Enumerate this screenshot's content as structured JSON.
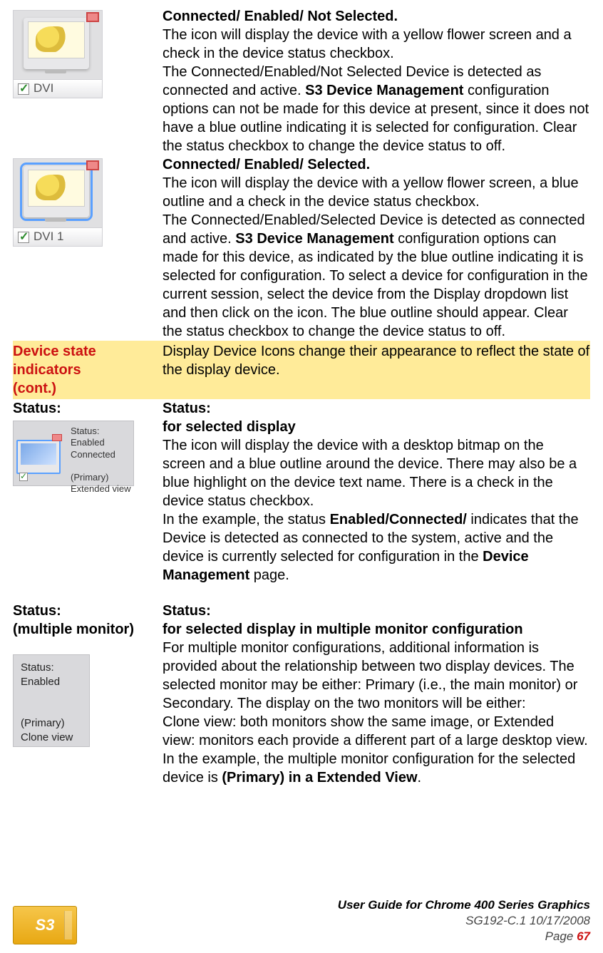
{
  "row1": {
    "icon_label": "DVI",
    "heading": "Connected/ Enabled/ Not Selected.",
    "p1a": "The icon will display the device with a yellow flower screen and a check in the device status checkbox.",
    "p1b_a": "The Connected/Enabled/Not Selected Device is detected as connected and active. ",
    "p1b_bold": "S3 Device Management",
    "p1b_c": " configuration options can not be made for this device at present, since it does not have a blue outline indicating it is selected for configuration. Clear the status checkbox to change the device status to off."
  },
  "row2": {
    "icon_label": "DVI 1",
    "heading": "Connected/ Enabled/ Selected.",
    "p1": "The icon will display the device with a yellow flower screen, a blue outline and a check in the device status checkbox.",
    "p2a": "The Connected/Enabled/Selected Device is detected as connected and active. ",
    "p2bold": "S3 Device Management",
    "p2b": " configuration options can made for this device, as indicated by the blue outline indicating it is selected for configuration. To select a device for configuration in the current session, select the device from the Display dropdown list and then click on the icon. The blue outline should appear. Clear the status checkbox to change the device status to off."
  },
  "yellow": {
    "left_l1": "Device state",
    "left_l2": "indicators",
    "left_l3": "(cont.)",
    "right": "Display Device Icons change their appearance to reflect the state of the display device."
  },
  "status1": {
    "left_heading": "Status:",
    "img_lines": "Status:\nEnabled\nConnected\n\n(Primary)\nExtended view",
    "heading": "Status:",
    "sub": "for selected display",
    "p1": "The icon will display the device with a desktop bitmap on the screen and a blue outline around the device. There may also be a blue highlight on the device text name. There is a check in the device status checkbox.",
    "p2a": "In the example, the status ",
    "p2bold1": "Enabled/Connected/",
    "p2b": " indicates that the Device is detected as connected to the system, active and the device is currently selected for configuration in the ",
    "p2bold2": "Device Management",
    "p2c": " page."
  },
  "status2": {
    "left_l1": "Status:",
    "left_l2": "(multiple monitor)",
    "img_lines": "Status:\nEnabled\n\n\n(Primary)\nClone view",
    "heading": "Status:",
    "sub": "for selected display in multiple monitor configuration",
    "p1": "For multiple monitor configurations, additional information is provided about the relationship between two display devices. The selected monitor may be either: Primary (i.e., the main monitor) or Secondary. The display on the two monitors will be either:",
    "p2a": "Clone view: both monitors show the same image, or Extended view: monitors each provide a different part of a large desktop view. In the example, the multiple monitor configuration for the selected device is ",
    "p2bold": "(Primary)  in a Extended View",
    "p2c": "."
  },
  "footer": {
    "logo_text": "S3",
    "title": "User Guide for Chrome 400 Series Graphics",
    "doc": "SG192-C.1   10/17/2008",
    "page_label": "Page ",
    "page_num": "67"
  }
}
